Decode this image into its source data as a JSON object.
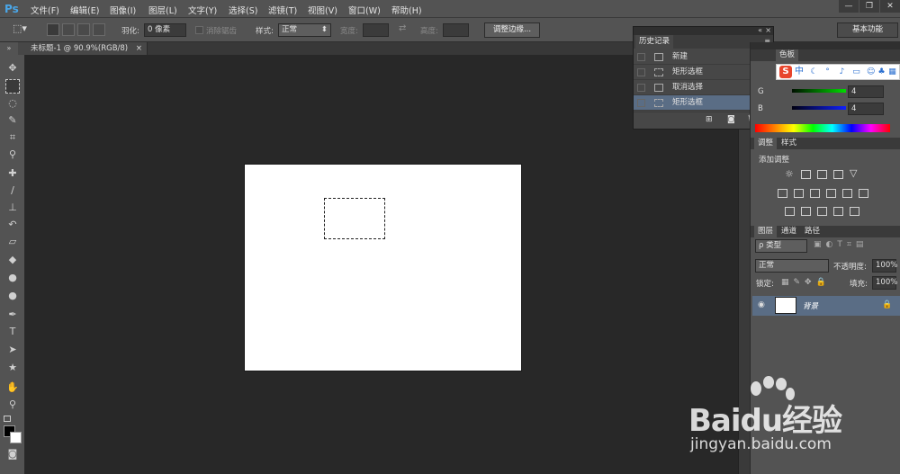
{
  "app": {
    "logo": "Ps"
  },
  "menu": [
    "文件(F)",
    "编辑(E)",
    "图像(I)",
    "图层(L)",
    "文字(Y)",
    "选择(S)",
    "滤镜(T)",
    "视图(V)",
    "窗口(W)",
    "帮助(H)"
  ],
  "window_controls": {
    "minimize": "—",
    "restore": "❐",
    "close": "✕"
  },
  "options": {
    "feather_label": "羽化:",
    "feather_value": "0 像素",
    "antialias_label": "消除锯齿",
    "style_label": "样式:",
    "style_value": "正常",
    "width_label": "宽度:",
    "height_label": "高度:",
    "refine_edge": "调整边缘...",
    "workspace": "基本功能"
  },
  "document": {
    "tab_title": "未标题-1 @ 90.9%(RGB/8)",
    "tab_close": "×"
  },
  "history": {
    "title": "历史记录",
    "items": [
      {
        "label": "新建",
        "icon": "document-icon"
      },
      {
        "label": "矩形选框",
        "icon": "marquee-icon"
      },
      {
        "label": "取消选择",
        "icon": "document-icon"
      },
      {
        "label": "矩形选框",
        "icon": "marquee-icon"
      }
    ],
    "selected_index": 3
  },
  "color_panel": {
    "title": "色板",
    "channels": [
      {
        "label": "G",
        "value": "4"
      },
      {
        "label": "B",
        "value": "4"
      }
    ]
  },
  "ime": {
    "logo": "S",
    "mode": "中"
  },
  "adjustments": {
    "tabs": [
      "调整",
      "样式"
    ],
    "heading": "添加调整"
  },
  "layers": {
    "tabs": [
      "图层",
      "通道",
      "路径"
    ],
    "filter_label": "ρ 类型",
    "blend_mode": "正常",
    "opacity_label": "不透明度:",
    "opacity_value": "100%",
    "lock_label": "锁定:",
    "fill_label": "填充:",
    "fill_value": "100%",
    "items": [
      {
        "name": "背景",
        "visible": true,
        "locked": true
      }
    ]
  },
  "watermark": {
    "brand": "Baidu经验",
    "url": "jingyan.baidu.com"
  }
}
